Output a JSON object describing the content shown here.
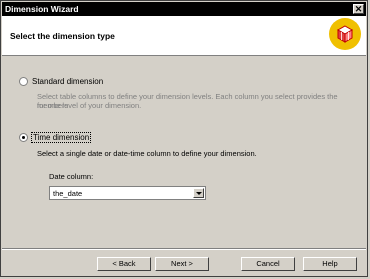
{
  "window": {
    "title": "Dimension Wizard",
    "close_glyph": "✕"
  },
  "header": {
    "title": "Select the dimension type",
    "icon": "wizard-cube-icon"
  },
  "options": {
    "standard": {
      "label": "Standard dimension",
      "description_line1": "Select table columns to define your dimension levels. Each column you select provides the members",
      "description_line2": "for one level of your dimension.",
      "selected": false
    },
    "time": {
      "label": "Time dimension",
      "description": "Select a single date or date-time column to define your dimension.",
      "selected": true
    }
  },
  "date_column": {
    "label": "Date column:",
    "value": "the_date"
  },
  "buttons": {
    "back": "< Back",
    "next": "Next >",
    "cancel": "Cancel",
    "help": "Help"
  }
}
